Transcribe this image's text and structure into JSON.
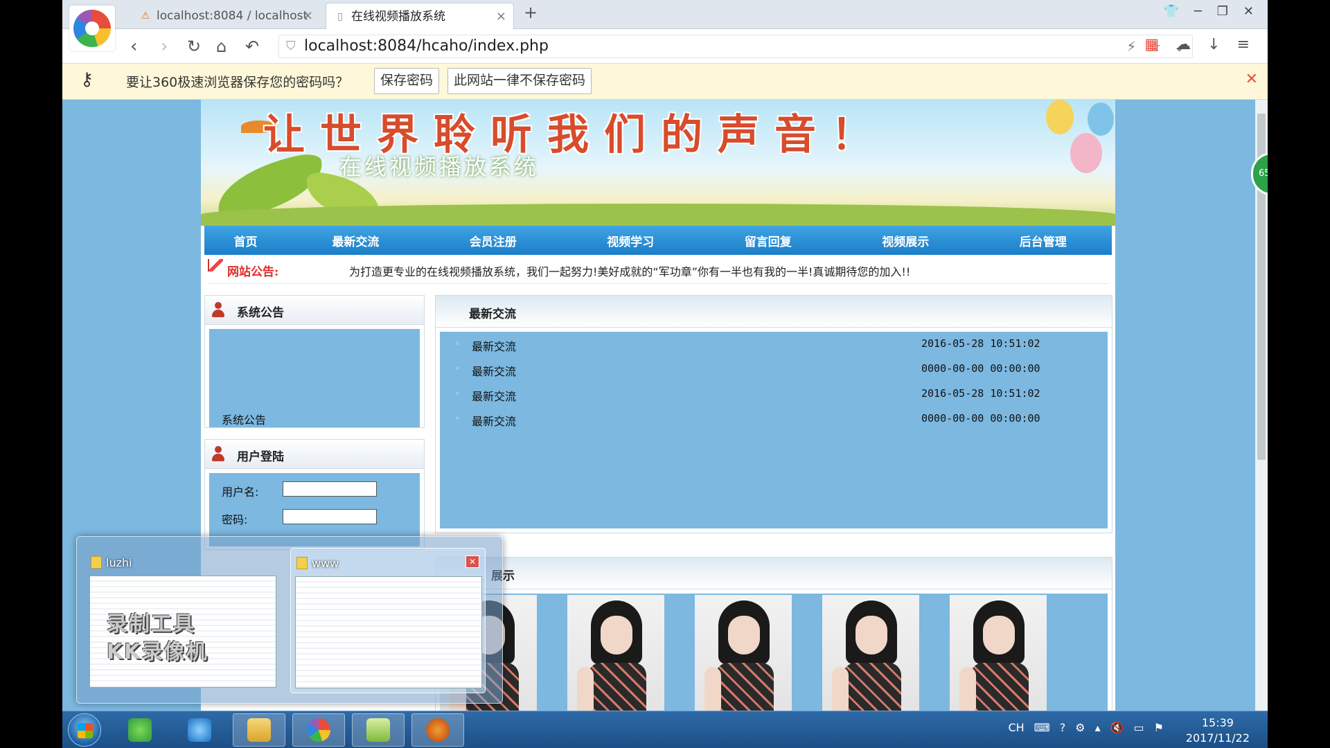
{
  "browser": {
    "tabs": [
      {
        "label": "localhost:8084 / localhost",
        "icon": "phpmyadmin-icon"
      },
      {
        "label": "在线视频播放系统",
        "icon": "page-icon"
      }
    ],
    "url": "localhost:8084/hcaho/index.php"
  },
  "password_bar": {
    "message": "要让360极速浏览器保存您的密码吗？",
    "save_label": "保存密码",
    "never_label": "此网站一律不保存密码"
  },
  "banner": {
    "slogan": "让世界聆听我们的声音！",
    "subtitle": "在线视频播放系统"
  },
  "nav": [
    "首页",
    "最新交流",
    "会员注册",
    "视频学习",
    "留言回复",
    "视频展示",
    "后台管理"
  ],
  "notice": {
    "label": "网站公告:",
    "text": "为打造更专业的在线视频播放系统，我们一起努力!美好成就的“军功章”你有一半也有我的一半!真诚期待您的加入!!"
  },
  "sys_notice": {
    "title": "系统公告",
    "item": "系统公告"
  },
  "login": {
    "title": "用户登陆",
    "username_label": "用户名:",
    "password_label": "密码:"
  },
  "latest": {
    "title": "最新交流",
    "rows": [
      {
        "title": "最新交流",
        "date": "2016-05-28 10:51:02"
      },
      {
        "title": "最新交流",
        "date": "0000-00-00 00:00:00"
      },
      {
        "title": "最新交流",
        "date": "2016-05-28 10:51:02"
      },
      {
        "title": "最新交流",
        "date": "0000-00-00 00:00:00"
      }
    ]
  },
  "gallery": {
    "title": "展示"
  },
  "peek": {
    "windows": [
      {
        "title": "luzhi",
        "watermark_line1": "录制工具",
        "watermark_line2": "KK录像机"
      },
      {
        "title": "www"
      }
    ]
  },
  "side_badge": "65",
  "taskbar": {
    "tray_lang": "CH",
    "time": "15:39",
    "date": "2017/11/22"
  }
}
